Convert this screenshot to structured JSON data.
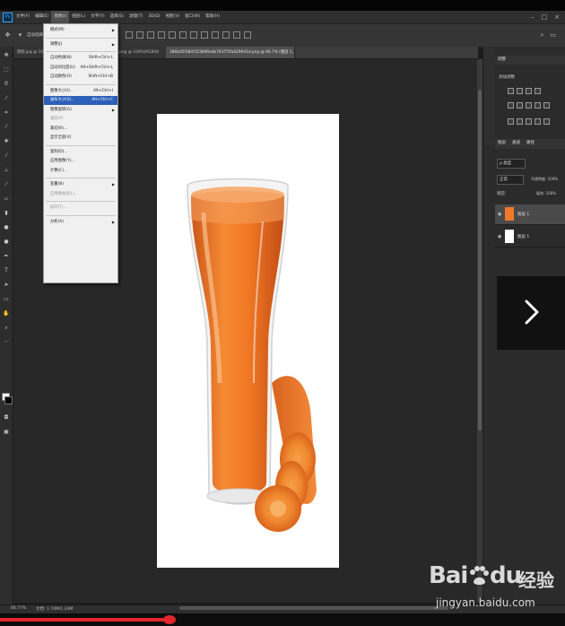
{
  "app": {
    "icon_label": "Ps"
  },
  "menubar": {
    "items": [
      "文件(F)",
      "编辑(E)",
      "图像(I)",
      "图层(L)",
      "文字(Y)",
      "选择(S)",
      "滤镜(T)",
      "3D(D)",
      "视图(V)",
      "窗口(W)",
      "帮助(H)"
    ],
    "active_index": 2
  },
  "options_bar": {
    "auto_select_label": "自动选择"
  },
  "tabs": [
    {
      "label": "刚图.jpg @ 100%(RGB/8)",
      "active": false
    },
    {
      "label": "...png @ 100%(RGB/8)",
      "active": false
    },
    {
      "label": "386bd5f3841f23b96edb761f75fa0296d1d.png @ 66.7% (图层 1, RGB/8) *",
      "active": true
    }
  ],
  "dropdown": {
    "items": [
      {
        "label": "模式(M)",
        "shortcut": "",
        "submenu": true,
        "disabled": false
      },
      {
        "sep": true
      },
      {
        "label": "调整(J)",
        "shortcut": "",
        "submenu": true,
        "disabled": false
      },
      {
        "sep": true
      },
      {
        "label": "自动色调(N)",
        "shortcut": "Shift+Ctrl+L",
        "submenu": false,
        "disabled": false
      },
      {
        "label": "自动对比度(U)",
        "shortcut": "Alt+Shift+Ctrl+L",
        "submenu": false,
        "disabled": false
      },
      {
        "label": "自动颜色(O)",
        "shortcut": "Shift+Ctrl+B",
        "submenu": false,
        "disabled": false
      },
      {
        "sep": true
      },
      {
        "label": "图像大小(I)...",
        "shortcut": "Alt+Ctrl+I",
        "submenu": false,
        "disabled": false
      },
      {
        "label": "画布大小(S)...",
        "shortcut": "Alt+Ctrl+C",
        "submenu": false,
        "disabled": false,
        "highlight": true
      },
      {
        "label": "图像旋转(G)",
        "shortcut": "",
        "submenu": true,
        "disabled": false
      },
      {
        "label": "裁剪(P)",
        "shortcut": "",
        "submenu": false,
        "disabled": true
      },
      {
        "label": "裁切(R)...",
        "shortcut": "",
        "submenu": false,
        "disabled": false
      },
      {
        "label": "显示全部(V)",
        "shortcut": "",
        "submenu": false,
        "disabled": false
      },
      {
        "sep": true
      },
      {
        "label": "复制(D)...",
        "shortcut": "",
        "submenu": false,
        "disabled": false
      },
      {
        "label": "应用图像(Y)...",
        "shortcut": "",
        "submenu": false,
        "disabled": false
      },
      {
        "label": "计算(C)...",
        "shortcut": "",
        "submenu": false,
        "disabled": false
      },
      {
        "sep": true
      },
      {
        "label": "变量(B)",
        "shortcut": "",
        "submenu": true,
        "disabled": false
      },
      {
        "label": "应用数据组(L)...",
        "shortcut": "",
        "submenu": false,
        "disabled": true
      },
      {
        "sep": true
      },
      {
        "label": "陷印(T)...",
        "shortcut": "",
        "submenu": false,
        "disabled": true
      },
      {
        "sep": true
      },
      {
        "label": "分析(A)",
        "shortcut": "",
        "submenu": true,
        "disabled": false
      }
    ]
  },
  "right_panel": {
    "adjust_tab": "调整",
    "add_adjust_label": "添加调整",
    "tabs": [
      "图层",
      "通道",
      "路径"
    ],
    "kind_label": "ρ 类型",
    "mode_label": "正常",
    "opacity_label": "不透明度: 100%",
    "lock_label": "锁定:",
    "fill_label": "填充: 100%",
    "layers": [
      {
        "name": "图层 1",
        "selected": true
      },
      {
        "name": "图层 1",
        "selected": false
      }
    ]
  },
  "status": {
    "zoom": "66.77%",
    "doc_info": "文档: 1.74M/1.33M"
  },
  "watermark": {
    "brand": "Bai",
    "brand2": "du",
    "cn": "经验",
    "url": "jingyan.baidu.com"
  },
  "progress": {
    "played_fraction": 0.3
  }
}
